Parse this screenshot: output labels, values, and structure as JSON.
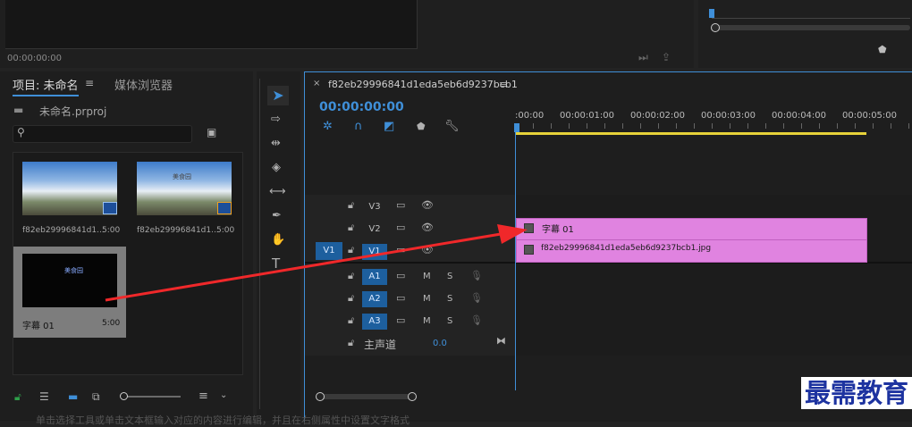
{
  "top": {
    "source_timecode": "00:00:00:00"
  },
  "project": {
    "tab_project": "项目: 未命名",
    "tab_media": "媒体浏览器",
    "file_name": "未命名.prproj",
    "search_placeholder": "",
    "items": [
      {
        "name": "f82eb29996841d1...",
        "duration": "5:00",
        "kind": "image"
      },
      {
        "name": "f82eb29996841d1...",
        "duration": "5:00",
        "kind": "image-title"
      },
      {
        "name": "字幕 01",
        "duration": "5:00",
        "kind": "title"
      }
    ],
    "thumb_caption": "美食园"
  },
  "timeline": {
    "sequence_name": "f82eb29996841d1eda5eb6d9237bcb1",
    "timecode": "00:00:00:00",
    "ruler": [
      ":00:00",
      "00:00:01:00",
      "00:00:02:00",
      "00:00:03:00",
      "00:00:04:00",
      "00:00:05:00"
    ],
    "video_tracks": [
      "V3",
      "V2",
      "V1"
    ],
    "source_patch": "V1",
    "audio_tracks": [
      "A1",
      "A2",
      "A3"
    ],
    "mute": "M",
    "solo": "S",
    "master_label": "主声道",
    "master_value": "0.0",
    "clips": {
      "v2": "字幕 01",
      "v1": "f82eb29996841d1eda5eb6d9237bcb1.jpg"
    }
  },
  "watermark": "最需教育",
  "bottom_caption": "单击选择工具或单击文本框输入对应的内容进行编辑，并且在右侧属性中设置文字格式"
}
